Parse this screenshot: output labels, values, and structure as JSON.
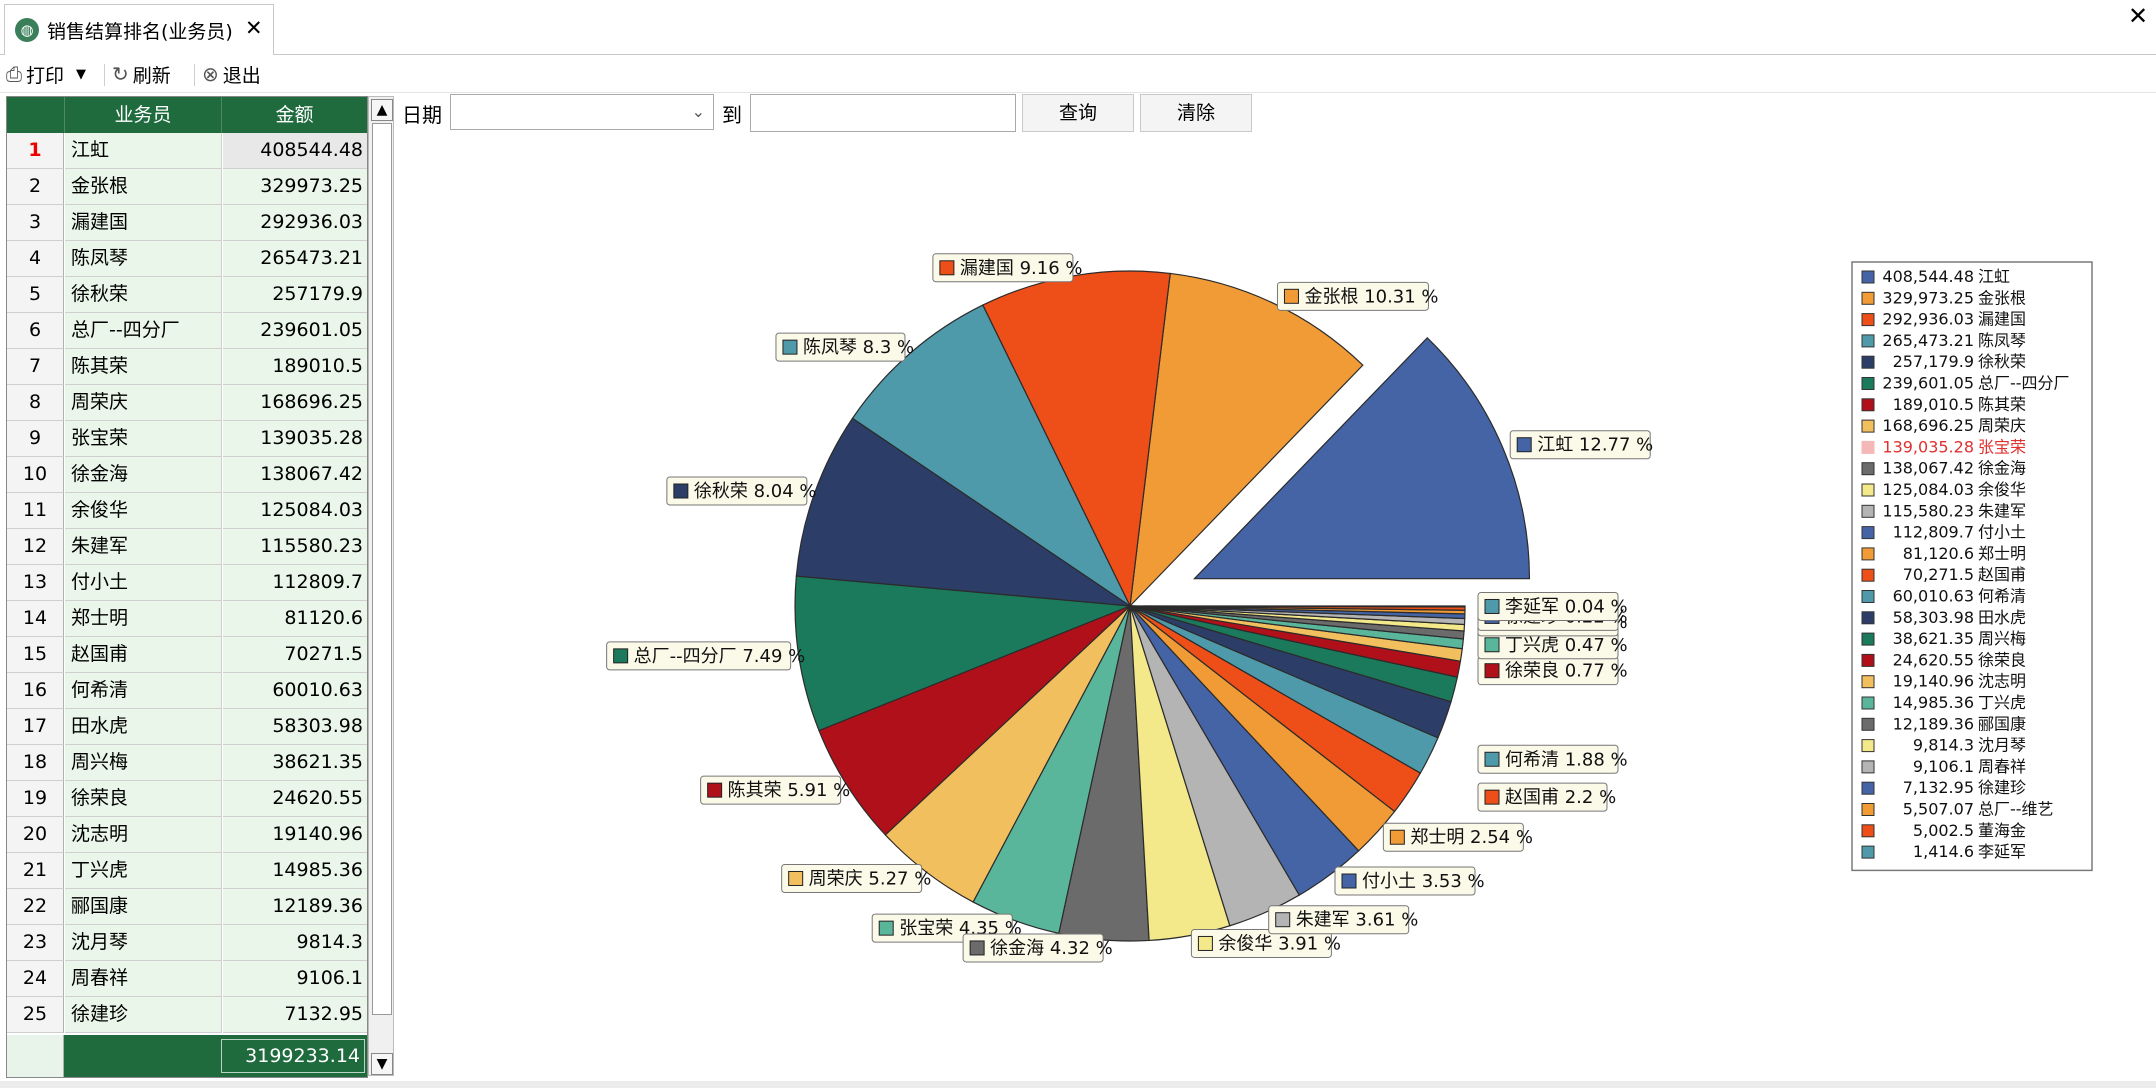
{
  "tab": {
    "icon": "globe-icon",
    "label": "销售结算排名(业务员)"
  },
  "toolbar": {
    "print_label": "打印",
    "refresh_label": "刷新",
    "exit_label": "退出"
  },
  "filter": {
    "date_label": "日期",
    "date_value": "",
    "to_label": "到",
    "to_value": "",
    "query_label": "查询",
    "clear_label": "清除"
  },
  "grid": {
    "headers": [
      "业务员",
      "金额"
    ],
    "rows": [
      {
        "index": "1",
        "name": "江虹",
        "amount": "408544.48"
      },
      {
        "index": "2",
        "name": "金张根",
        "amount": "329973.25"
      },
      {
        "index": "3",
        "name": "漏建国",
        "amount": "292936.03"
      },
      {
        "index": "4",
        "name": "陈凤琴",
        "amount": "265473.21"
      },
      {
        "index": "5",
        "name": "徐秋荣",
        "amount": "257179.9"
      },
      {
        "index": "6",
        "name": "总厂--四分厂",
        "amount": "239601.05"
      },
      {
        "index": "7",
        "name": "陈其荣",
        "amount": "189010.5"
      },
      {
        "index": "8",
        "name": "周荣庆",
        "amount": "168696.25"
      },
      {
        "index": "9",
        "name": "张宝荣",
        "amount": "139035.28"
      },
      {
        "index": "10",
        "name": "徐金海",
        "amount": "138067.42"
      },
      {
        "index": "11",
        "name": "余俊华",
        "amount": "125084.03"
      },
      {
        "index": "12",
        "name": "朱建军",
        "amount": "115580.23"
      },
      {
        "index": "13",
        "name": "付小土",
        "amount": "112809.7"
      },
      {
        "index": "14",
        "name": "郑士明",
        "amount": "81120.6"
      },
      {
        "index": "15",
        "name": "赵国甫",
        "amount": "70271.5"
      },
      {
        "index": "16",
        "name": "何希清",
        "amount": "60010.63"
      },
      {
        "index": "17",
        "name": "田水虎",
        "amount": "58303.98"
      },
      {
        "index": "18",
        "name": "周兴梅",
        "amount": "38621.35"
      },
      {
        "index": "19",
        "name": "徐荣良",
        "amount": "24620.55"
      },
      {
        "index": "20",
        "name": "沈志明",
        "amount": "19140.96"
      },
      {
        "index": "21",
        "name": "丁兴虎",
        "amount": "14985.36"
      },
      {
        "index": "22",
        "name": "郦国康",
        "amount": "12189.36"
      },
      {
        "index": "23",
        "name": "沈月琴",
        "amount": "9814.3"
      },
      {
        "index": "24",
        "name": "周春祥",
        "amount": "9106.1"
      },
      {
        "index": "25",
        "name": "徐建珍",
        "amount": "7132.95"
      }
    ],
    "total": "3199233.14",
    "selected_index": 1
  },
  "chart_data": {
    "type": "pie",
    "exploded": "江虹",
    "highlighted_legend_entry": "张宝荣",
    "colors": {
      "highlight_text": "#e03030"
    },
    "slices": [
      {
        "name": "江虹",
        "value": 408544.48,
        "value_label": "408,544.48",
        "pct": 12.77,
        "color": "#4464a6",
        "label": "江虹 12.77 %"
      },
      {
        "name": "金张根",
        "value": 329973.25,
        "value_label": "329,973.25",
        "pct": 10.31,
        "color": "#f19b36",
        "label": "金张根 10.31 %"
      },
      {
        "name": "漏建国",
        "value": 292936.03,
        "value_label": "292,936.03",
        "pct": 9.16,
        "color": "#ee4e18",
        "label": "漏建国 9.16 %"
      },
      {
        "name": "陈凤琴",
        "value": 265473.21,
        "value_label": "265,473.21",
        "pct": 8.3,
        "color": "#4f9aaa",
        "label": "陈凤琴 8.3 %"
      },
      {
        "name": "徐秋荣",
        "value": 257179.9,
        "value_label": "257,179.9",
        "pct": 8.04,
        "color": "#2c3e68",
        "label": "徐秋荣 8.04 %"
      },
      {
        "name": "总厂--四分厂",
        "value": 239601.05,
        "value_label": "239,601.05",
        "pct": 7.49,
        "color": "#1b7a5c",
        "label": "总厂--四分厂 7.49 %"
      },
      {
        "name": "陈其荣",
        "value": 189010.5,
        "value_label": "189,010.5",
        "pct": 5.91,
        "color": "#b0101a",
        "label": "陈其荣 5.91 %"
      },
      {
        "name": "周荣庆",
        "value": 168696.25,
        "value_label": "168,696.25",
        "pct": 5.27,
        "color": "#f2bf5e",
        "label": "周荣庆 5.27 %"
      },
      {
        "name": "张宝荣",
        "value": 139035.28,
        "value_label": "139,035.28",
        "pct": 4.35,
        "color": "#5ab69b",
        "label": "张宝荣 4.35 %"
      },
      {
        "name": "徐金海",
        "value": 138067.42,
        "value_label": "138,067.42",
        "pct": 4.32,
        "color": "#6b6b6b",
        "label": "徐金海 4.32 %"
      },
      {
        "name": "余俊华",
        "value": 125084.03,
        "value_label": "125,084.03",
        "pct": 3.91,
        "color": "#f3e88a",
        "label": "余俊华 3.91 %"
      },
      {
        "name": "朱建军",
        "value": 115580.23,
        "value_label": "115,580.23",
        "pct": 3.61,
        "color": "#b4b4b4",
        "label": "朱建军 3.61 %"
      },
      {
        "name": "付小土",
        "value": 112809.7,
        "value_label": "112,809.7",
        "pct": 3.53,
        "color": "#4464a6",
        "label": "付小土 3.53 %"
      },
      {
        "name": "郑士明",
        "value": 81120.6,
        "value_label": "81,120.6",
        "pct": 2.54,
        "color": "#f19b36",
        "label": "郑士明 2.54 %"
      },
      {
        "name": "赵国甫",
        "value": 70271.5,
        "value_label": "70,271.5",
        "pct": 2.2,
        "color": "#ee4e18",
        "label": "赵国甫 2.2 %"
      },
      {
        "name": "何希清",
        "value": 60010.63,
        "value_label": "60,010.63",
        "pct": 1.88,
        "color": "#4f9aaa",
        "label": "何希清 1.88 %"
      },
      {
        "name": "田水虎",
        "value": 58303.98,
        "value_label": "58,303.98",
        "pct": 1.82,
        "color": "#2c3e68",
        "label": ""
      },
      {
        "name": "周兴梅",
        "value": 38621.35,
        "value_label": "38,621.35",
        "pct": 1.21,
        "color": "#1b7a5c",
        "label": ""
      },
      {
        "name": "徐荣良",
        "value": 24620.55,
        "value_label": "24,620.55",
        "pct": 0.77,
        "color": "#b0101a",
        "label": "徐荣良 0.77 %"
      },
      {
        "name": "沈志明",
        "value": 19140.96,
        "value_label": "19,140.96",
        "pct": 0.6,
        "color": "#f2bf5e",
        "label": ""
      },
      {
        "name": "丁兴虎",
        "value": 14985.36,
        "value_label": "14,985.36",
        "pct": 0.47,
        "color": "#5ab69b",
        "label": "丁兴虎 0.47 %"
      },
      {
        "name": "郦国康",
        "value": 12189.36,
        "value_label": "12,189.36",
        "pct": 0.38,
        "color": "#6b6b6b",
        "label": ""
      },
      {
        "name": "沈月琴",
        "value": 9814.3,
        "value_label": "9,814.3",
        "pct": 0.31,
        "color": "#f3e88a",
        "label": ""
      },
      {
        "name": "周春祥",
        "value": 9106.1,
        "value_label": "9,106.1",
        "pct": 0.28,
        "color": "#b4b4b4",
        "label": "周春祥 0.28 %"
      },
      {
        "name": "徐建珍",
        "value": 7132.95,
        "value_label": "7,132.95",
        "pct": 0.22,
        "color": "#4464a6",
        "label": "徐建珍 0.22 %"
      },
      {
        "name": "总厂--维艺",
        "value": 5507.07,
        "value_label": "5,507.07",
        "pct": 0.17,
        "color": "#f19b36",
        "label": ""
      },
      {
        "name": "董海金",
        "value": 5002.5,
        "value_label": "5,002.5",
        "pct": 0.16,
        "color": "#ee4e18",
        "label": ""
      },
      {
        "name": "李延军",
        "value": 1414.6,
        "value_label": "1,414.6",
        "pct": 0.04,
        "color": "#4f9aaa",
        "label": "李延军 0.04 %"
      }
    ]
  }
}
